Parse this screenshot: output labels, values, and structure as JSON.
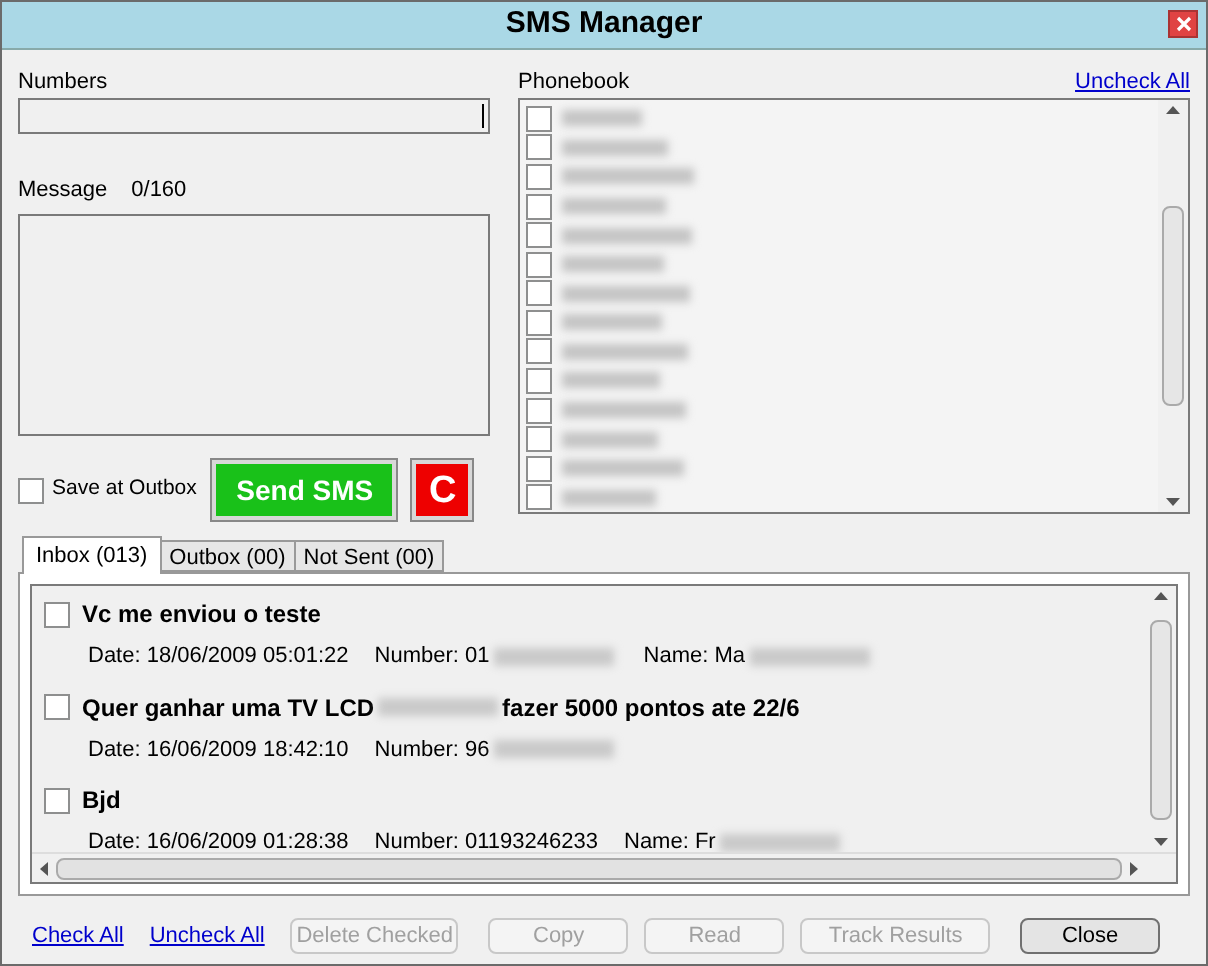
{
  "window": {
    "title": "SMS Manager"
  },
  "numbers": {
    "label": "Numbers"
  },
  "message": {
    "label": "Message",
    "counter": "0/160"
  },
  "save_at_outbox": {
    "label": "Save at Outbox",
    "checked": false
  },
  "send_button": "Send SMS",
  "clear_button": "C",
  "phonebook": {
    "label": "Phonebook",
    "uncheck_all": "Uncheck All",
    "entries": [
      {
        "checked": false
      },
      {
        "checked": false
      },
      {
        "checked": false
      },
      {
        "checked": false
      },
      {
        "checked": false
      },
      {
        "checked": false
      },
      {
        "checked": false
      },
      {
        "checked": false
      },
      {
        "checked": false
      },
      {
        "checked": false
      },
      {
        "checked": false
      },
      {
        "checked": false
      },
      {
        "checked": false
      },
      {
        "checked": false
      }
    ]
  },
  "tabs": [
    {
      "label": "Inbox (013)",
      "selected": true
    },
    {
      "label": "Outbox (00)",
      "selected": false
    },
    {
      "label": "Not Sent (00)",
      "selected": false
    }
  ],
  "messages": [
    {
      "checked": false,
      "subject": [
        {
          "kind": "text",
          "text": "Vc me enviou o teste"
        }
      ],
      "details": [
        [
          {
            "kind": "text",
            "text": "Date: 18/06/2009 05:01:22"
          }
        ],
        [
          {
            "kind": "text",
            "text": "Number: 01"
          },
          {
            "kind": "redacted"
          }
        ],
        [
          {
            "kind": "text",
            "text": "Name: Ma"
          },
          {
            "kind": "redacted"
          }
        ]
      ]
    },
    {
      "checked": false,
      "subject": [
        {
          "kind": "text",
          "text": "Quer ganhar uma TV LCD"
        },
        {
          "kind": "redacted"
        },
        {
          "kind": "text",
          "text": "fazer 5000 pontos ate 22/6"
        }
      ],
      "details": [
        [
          {
            "kind": "text",
            "text": "Date: 16/06/2009 18:42:10"
          }
        ],
        [
          {
            "kind": "text",
            "text": "Number: 96"
          },
          {
            "kind": "redacted"
          }
        ]
      ]
    },
    {
      "checked": false,
      "subject": [
        {
          "kind": "text",
          "text": "Bjd"
        }
      ],
      "details": [
        [
          {
            "kind": "text",
            "text": "Date: 16/06/2009 01:28:38"
          }
        ],
        [
          {
            "kind": "text",
            "text": "Number: 01193246233"
          }
        ],
        [
          {
            "kind": "text",
            "text": "Name: Fr"
          },
          {
            "kind": "redacted"
          }
        ]
      ]
    }
  ],
  "footer": {
    "links": [
      "Check All",
      "Uncheck All"
    ],
    "buttons": [
      {
        "label": "Delete Checked",
        "disabled": true
      },
      {
        "label": "Copy",
        "disabled": true
      },
      {
        "label": "Read",
        "disabled": true
      },
      {
        "label": "Track Results",
        "disabled": true
      },
      {
        "label": "Close",
        "disabled": false
      }
    ]
  }
}
